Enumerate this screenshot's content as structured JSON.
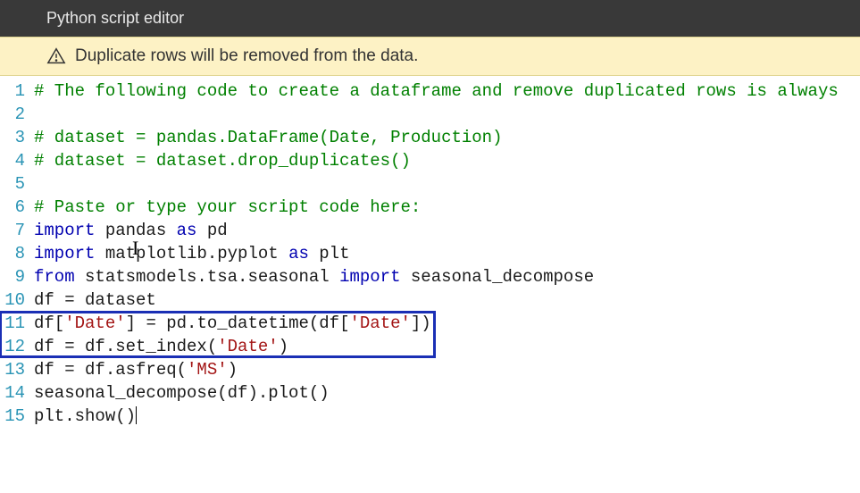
{
  "header": {
    "title": "Python script editor"
  },
  "warning": {
    "message": "Duplicate rows will be removed from the data."
  },
  "editor": {
    "highlighted_lines": {
      "start": 11,
      "end": 12
    },
    "lines": [
      {
        "n": 1,
        "tokens": [
          {
            "t": "# The following code to create a dataframe and remove duplicated rows is always",
            "c": "comment"
          }
        ]
      },
      {
        "n": 2,
        "tokens": []
      },
      {
        "n": 3,
        "tokens": [
          {
            "t": "# dataset = pandas.DataFrame(Date, Production)",
            "c": "comment"
          }
        ]
      },
      {
        "n": 4,
        "tokens": [
          {
            "t": "# dataset = dataset.drop_duplicates()",
            "c": "comment"
          }
        ]
      },
      {
        "n": 5,
        "tokens": []
      },
      {
        "n": 6,
        "tokens": [
          {
            "t": "# Paste or type your script code here:",
            "c": "comment"
          }
        ]
      },
      {
        "n": 7,
        "tokens": [
          {
            "t": "import",
            "c": "keyword"
          },
          {
            "t": " pandas ",
            "c": "ident"
          },
          {
            "t": "as",
            "c": "keyword"
          },
          {
            "t": " pd",
            "c": "ident"
          }
        ]
      },
      {
        "n": 8,
        "tokens": [
          {
            "t": "import",
            "c": "keyword"
          },
          {
            "t": " matplotlib.pyplot ",
            "c": "ident"
          },
          {
            "t": "as",
            "c": "keyword"
          },
          {
            "t": " plt",
            "c": "ident"
          }
        ]
      },
      {
        "n": 9,
        "tokens": [
          {
            "t": "from",
            "c": "keyword"
          },
          {
            "t": " statsmodels.tsa.seasonal ",
            "c": "ident"
          },
          {
            "t": "import",
            "c": "keyword"
          },
          {
            "t": " seasonal_decompose",
            "c": "ident"
          }
        ]
      },
      {
        "n": 10,
        "tokens": [
          {
            "t": "df = dataset",
            "c": "ident"
          }
        ]
      },
      {
        "n": 11,
        "tokens": [
          {
            "t": "df[",
            "c": "ident"
          },
          {
            "t": "'Date'",
            "c": "string"
          },
          {
            "t": "] = pd.to_datetime(df[",
            "c": "ident"
          },
          {
            "t": "'Date'",
            "c": "string"
          },
          {
            "t": "])",
            "c": "ident"
          }
        ]
      },
      {
        "n": 12,
        "tokens": [
          {
            "t": "df = df.set_index(",
            "c": "ident"
          },
          {
            "t": "'Date'",
            "c": "string"
          },
          {
            "t": ")",
            "c": "ident"
          }
        ]
      },
      {
        "n": 13,
        "tokens": [
          {
            "t": "df = df.asfreq(",
            "c": "ident"
          },
          {
            "t": "'MS'",
            "c": "string"
          },
          {
            "t": ")",
            "c": "ident"
          }
        ]
      },
      {
        "n": 14,
        "tokens": [
          {
            "t": "seasonal_decompose(df).plot()",
            "c": "ident"
          }
        ]
      },
      {
        "n": 15,
        "tokens": [
          {
            "t": "plt.show()",
            "c": "ident"
          }
        ]
      }
    ]
  }
}
